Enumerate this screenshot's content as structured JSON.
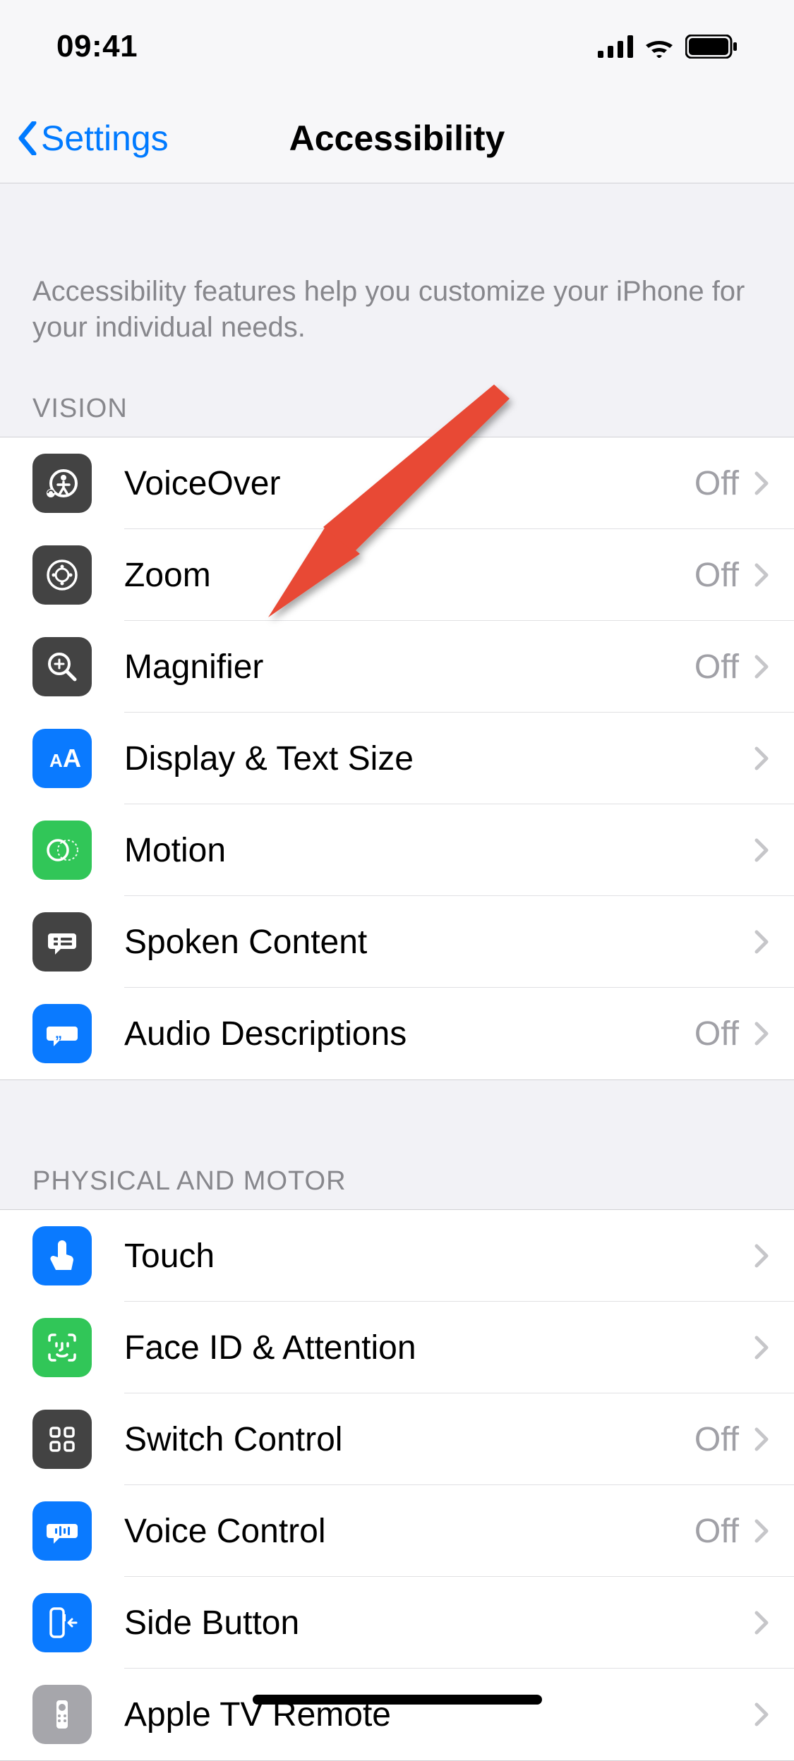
{
  "status": {
    "time": "09:41"
  },
  "nav": {
    "back_label": "Settings",
    "title": "Accessibility"
  },
  "description": "Accessibility features help you customize your iPhone for your individual needs.",
  "sections": {
    "vision": {
      "header": "VISION",
      "items": [
        {
          "icon": "voiceover-icon",
          "bg": "ic-dark",
          "label": "VoiceOver",
          "value": "Off"
        },
        {
          "icon": "zoom-icon",
          "bg": "ic-dark",
          "label": "Zoom",
          "value": "Off"
        },
        {
          "icon": "magnifier-icon",
          "bg": "ic-dark",
          "label": "Magnifier",
          "value": "Off"
        },
        {
          "icon": "text-size-icon",
          "bg": "ic-blue",
          "label": "Display & Text Size",
          "value": ""
        },
        {
          "icon": "motion-icon",
          "bg": "ic-green",
          "label": "Motion",
          "value": ""
        },
        {
          "icon": "spoken-content-icon",
          "bg": "ic-dark",
          "label": "Spoken Content",
          "value": ""
        },
        {
          "icon": "audio-descriptions-icon",
          "bg": "ic-blue",
          "label": "Audio Descriptions",
          "value": "Off"
        }
      ]
    },
    "physical": {
      "header": "PHYSICAL AND MOTOR",
      "items": [
        {
          "icon": "touch-icon",
          "bg": "ic-blue",
          "label": "Touch",
          "value": ""
        },
        {
          "icon": "faceid-icon",
          "bg": "ic-green",
          "label": "Face ID & Attention",
          "value": ""
        },
        {
          "icon": "switch-control-icon",
          "bg": "ic-dark",
          "label": "Switch Control",
          "value": "Off"
        },
        {
          "icon": "voice-control-icon",
          "bg": "ic-blue",
          "label": "Voice Control",
          "value": "Off"
        },
        {
          "icon": "side-button-icon",
          "bg": "ic-blue",
          "label": "Side Button",
          "value": ""
        },
        {
          "icon": "apple-tv-remote-icon",
          "bg": "ic-grey",
          "label": "Apple TV Remote",
          "value": ""
        }
      ]
    }
  },
  "annotation": {
    "arrow_color": "#e84a34"
  }
}
